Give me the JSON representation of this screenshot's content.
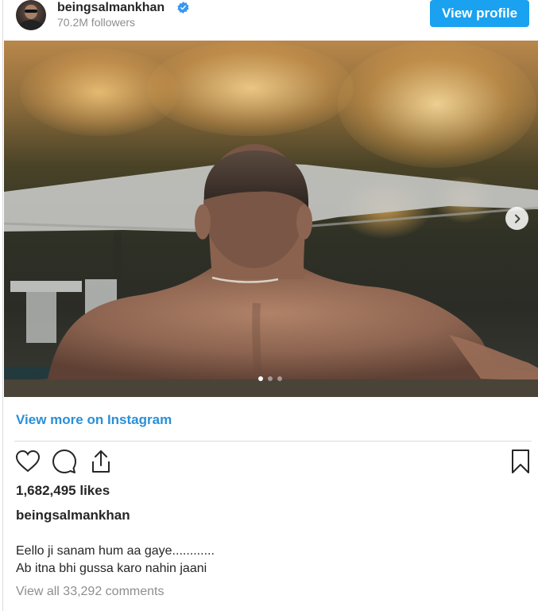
{
  "header": {
    "username": "beingsalmankhan",
    "followers": "70.2M followers",
    "view_profile_label": "View profile"
  },
  "icons": {
    "verified": "verified-badge-icon",
    "next": "chevron-right-icon",
    "like": "heart-icon",
    "comment": "comment-bubble-icon",
    "share": "share-icon",
    "save": "bookmark-icon"
  },
  "colors": {
    "accent": "#1aa1f0",
    "link": "#2a8fd6",
    "muted": "#8e8e8e",
    "text": "#262626"
  },
  "carousel": {
    "total": 3,
    "active_index": 0
  },
  "view_more_label": "View more on Instagram",
  "post": {
    "likes": "1,682,495 likes",
    "caption_username": "beingsalmankhan",
    "caption_line1": "Eello ji sanam hum aa gaye............",
    "caption_line2": "Ab itna bhi gussa karo nahin jaani",
    "comments_link": "View all 33,292 comments"
  }
}
